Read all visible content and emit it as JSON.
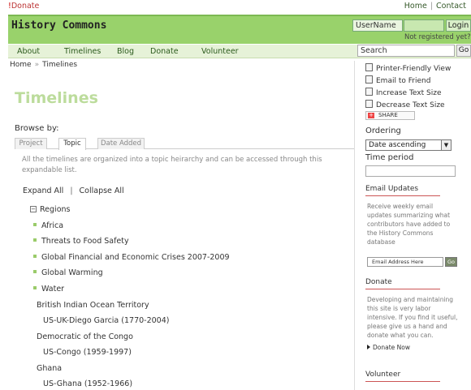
{
  "topbar": {
    "donate_label": "Donate",
    "home_label": "Home",
    "contact_label": "Contact"
  },
  "header": {
    "site_title": "History Commons",
    "username_value": "UserName",
    "login_label": "Login",
    "not_registered": "Not registered yet?"
  },
  "nav": {
    "items": [
      "About",
      "Timelines",
      "Blog",
      "Donate",
      "Volunteer"
    ],
    "search_value": "Search",
    "go_label": "Go"
  },
  "breadcrumb": {
    "home": "Home",
    "current": "Timelines"
  },
  "main": {
    "title": "Timelines",
    "browse_by": "Browse by:",
    "tabs": [
      "Project",
      "Topic",
      "Date Added"
    ],
    "active_tab": "Topic",
    "intro_line1": "All the timelines are organized into a topic heirarchy and can be accessed through this",
    "intro_line2": "expandable list.",
    "expand_all": "Expand All",
    "expand_sep": "|",
    "collapse_all": "Collapse All",
    "regions_label": "Regions",
    "region_items": [
      "Africa",
      "Threats to Food Safety",
      "Global Financial and Economic Crises 2007-2009",
      "Global Warming",
      "Water"
    ],
    "countries": [
      {
        "name": "British Indian Ocean Territory",
        "timeline": "US-UK-Diego Garcia (1770-2004)"
      },
      {
        "name": "Democratic of the Congo",
        "timeline": "US-Congo (1959-1997)"
      },
      {
        "name": "Ghana",
        "timeline": "US-Ghana (1952-1966)"
      }
    ]
  },
  "sidebar": {
    "printer_friendly": "Printer-Friendly View",
    "email_friend": "Email to Friend",
    "increase_text": "Increase Text Size",
    "decrease_text": "Decrease Text Size",
    "share_label": "SHARE",
    "ordering_label": "Ordering",
    "ordering_value": "Date ascending",
    "time_period_label": "Time period",
    "email_updates_head": "Email Updates",
    "email_updates_text": "Receive weekly email updates summarizing what contributors have added to the History Commons database",
    "email_placeholder": "Email Address Here",
    "email_go": "Go",
    "donate_head": "Donate",
    "donate_text": "Developing and maintaining this site is very labor intensive. If you find it useful, please give us a hand and donate what you can.",
    "donate_now": "Donate Now",
    "volunteer_head": "Volunteer"
  },
  "colors": {
    "header_green": "#99d26b",
    "title_green": "#bcdc9c",
    "accent_red": "#cc5555"
  }
}
